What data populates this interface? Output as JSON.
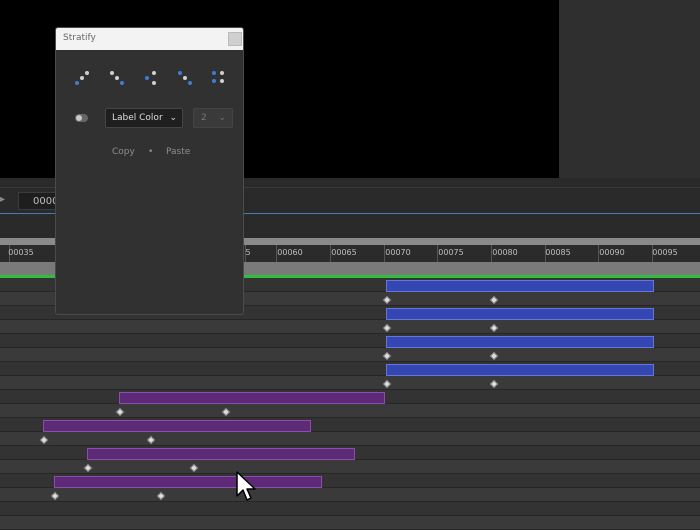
{
  "panel": {
    "title": "Stratify",
    "buttons": [
      {
        "name": "stratify-pattern-1-button"
      },
      {
        "name": "stratify-pattern-2-button"
      },
      {
        "name": "stratify-pattern-3-button"
      },
      {
        "name": "stratify-pattern-4-button"
      },
      {
        "name": "stratify-pattern-5-button"
      }
    ],
    "mode_select": "Label Color",
    "count_select": "2",
    "copy_label": "Copy",
    "separator": "•",
    "paste_label": "Paste"
  },
  "timeline": {
    "timecode": "00000",
    "ruler_labels": [
      "00035",
      "5",
      "00060",
      "00065",
      "00070",
      "00075",
      "00080",
      "00085",
      "00090",
      "00095"
    ]
  },
  "colors": {
    "accent_blue": "#3d7bd9",
    "layer_blue": "#3547b3",
    "layer_purple": "#5c2a77",
    "work_area_green": "#2fbf3a"
  },
  "icons": [
    "close-icon",
    "toggle-icon",
    "chevron-down-icon",
    "mouse-cursor-icon"
  ]
}
